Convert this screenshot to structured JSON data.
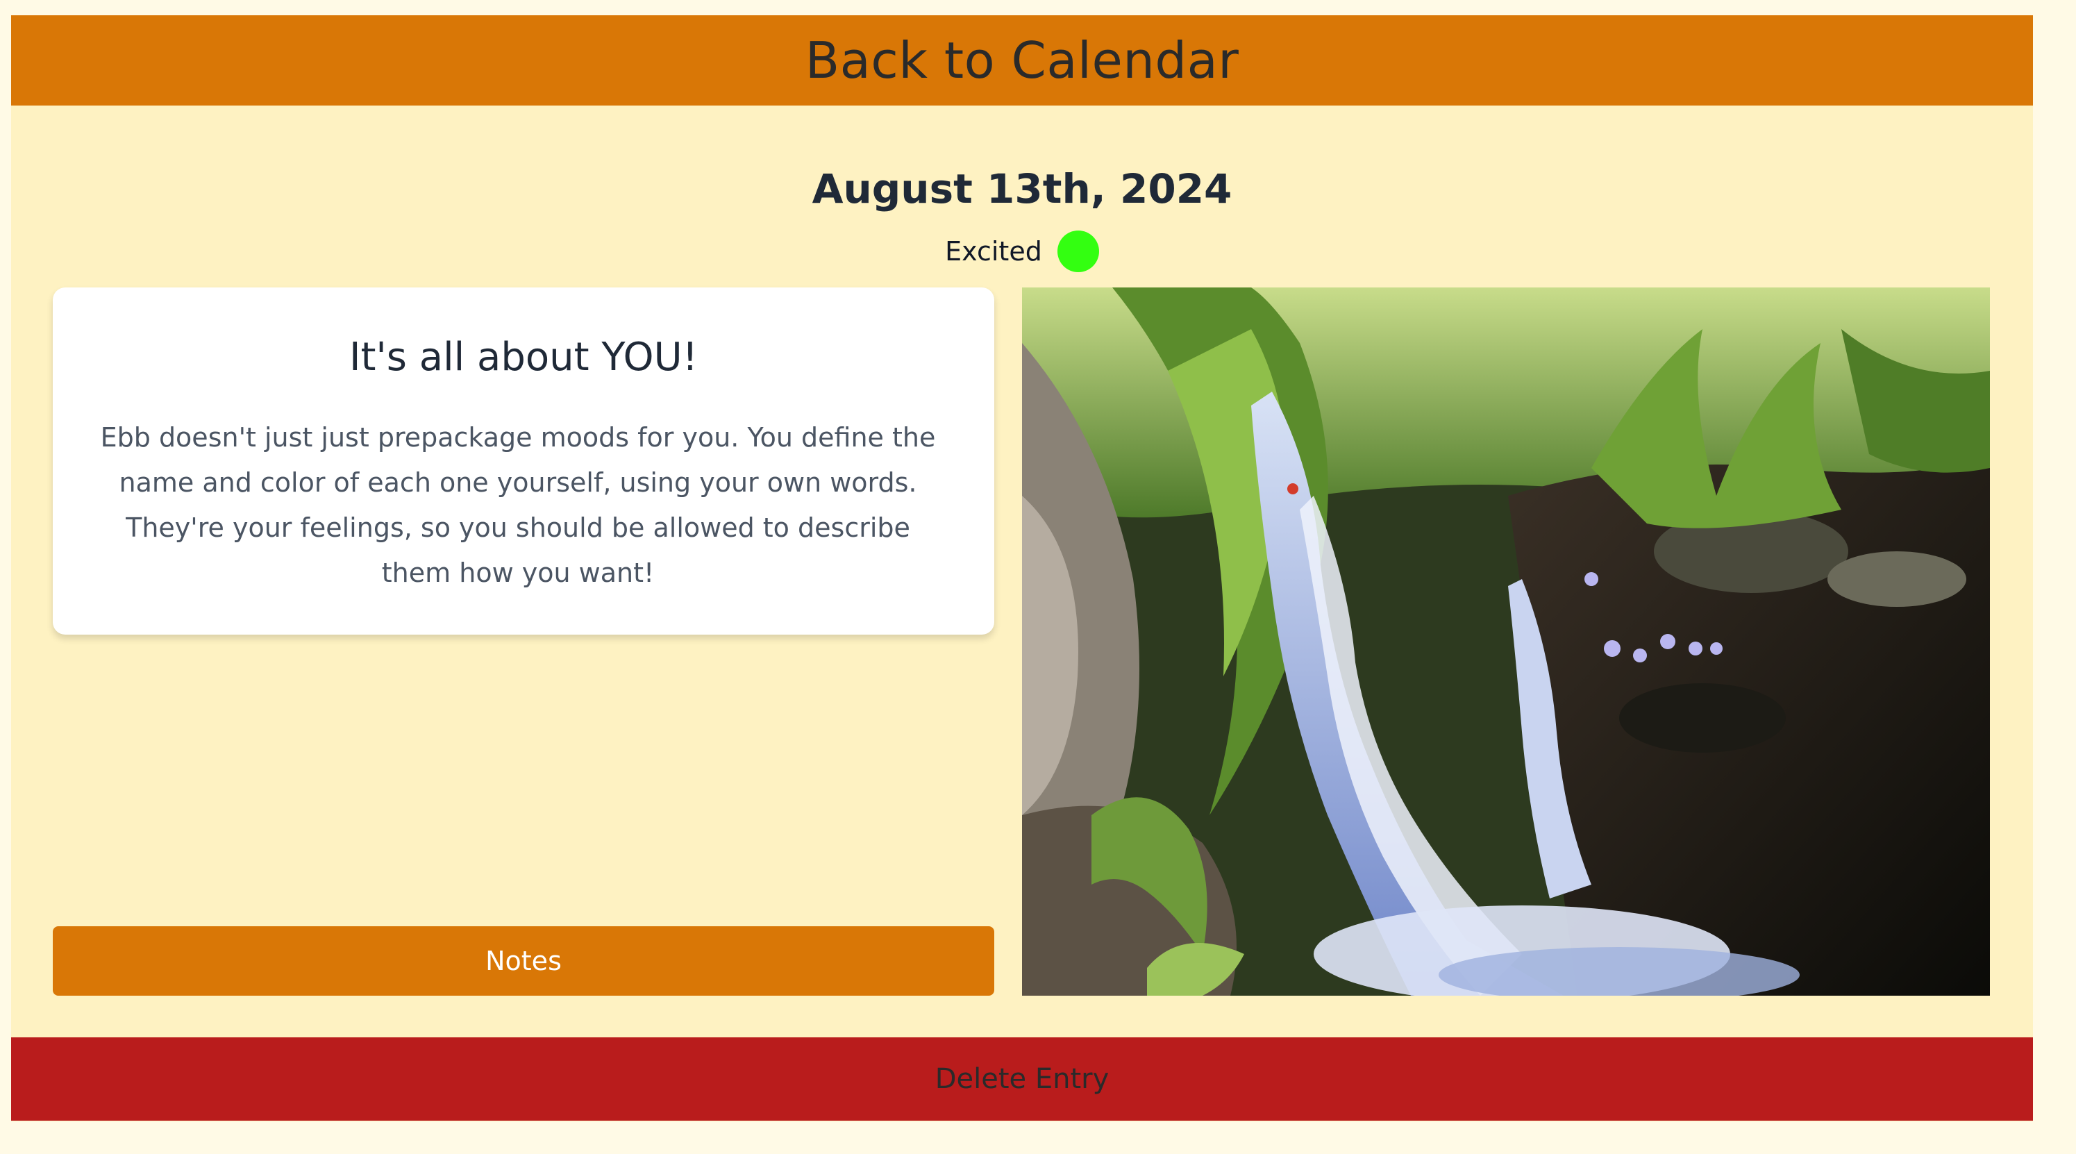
{
  "nav": {
    "back_label": "Back to Calendar"
  },
  "entry": {
    "date": "August 13th, 2024",
    "mood": {
      "label": "Excited",
      "color": "#33ff11"
    }
  },
  "card": {
    "title": "It's all about YOU!",
    "body": "Ebb doesn't just just prepackage moods for you. You define the name and color of each one yourself, using your own words. They're your feelings, so you should be allowed to describe them how you want!"
  },
  "actions": {
    "notes_label": "Notes",
    "delete_label": "Delete Entry"
  },
  "photo": {
    "icon": "waterfall-photo"
  },
  "colors": {
    "page_bg": "#fffae6",
    "panel_bg": "#fef2c2",
    "accent": "#d97706",
    "danger": "#b91c1c"
  }
}
